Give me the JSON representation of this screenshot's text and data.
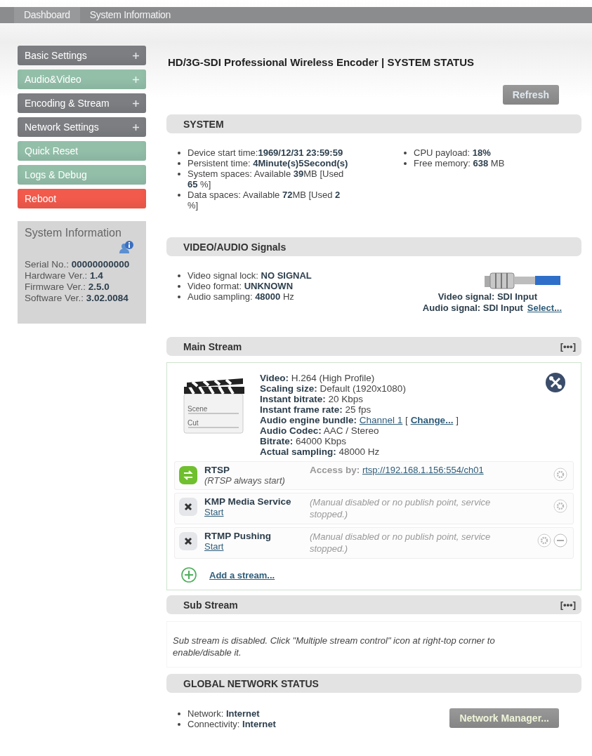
{
  "tabs": [
    {
      "label": "Dashboard",
      "selected": true
    },
    {
      "label": "System Information",
      "selected": false
    }
  ],
  "sidebar": {
    "items": [
      {
        "label": "Basic Settings",
        "color": "#7d7e82",
        "expandable": true
      },
      {
        "label": "Audio&Video",
        "color": "#93bfa9",
        "expandable": true
      },
      {
        "label": "Encoding & Stream",
        "color": "#7d7e82",
        "expandable": true
      },
      {
        "label": "Network Settings",
        "color": "#7d7e82",
        "expandable": true
      },
      {
        "label": "Quick Reset",
        "color": "#93bfa9",
        "expandable": false
      },
      {
        "label": "Logs & Debug",
        "color": "#93bfa9",
        "expandable": false
      },
      {
        "label": "Reboot",
        "color": "#f25a4c",
        "expandable": false
      }
    ],
    "info_panel": {
      "title": "System Information",
      "lines": [
        "Serial No.: **00000000000**",
        "Hardware Ver.: **1.4**",
        "Firmware Ver.: **2.5.0**",
        "Software Ver.: **3.02.0084**"
      ]
    }
  },
  "page_title": "HD/3G-SDI Professional Wireless Encoder | SYSTEM STATUS",
  "refresh_button": "Refresh",
  "system": {
    "title": "SYSTEM",
    "left": [
      "Device start time:**1969/12/31 23:59:59**",
      "Persistent time: **4Minute(s)5Second(s)**",
      "System spaces: Available **39**MB [Used **65** %]",
      "Data spaces: Available **72**MB [Used **2** %]"
    ],
    "right": [
      "CPU payload: **18%**",
      "Free memory: **638** MB"
    ]
  },
  "signals": {
    "title": "VIDEO/AUDIO Signals",
    "items": [
      "Video signal lock: **NO SIGNAL**",
      "Video format: **UNKNOWN**",
      "Audio sampling: **48000** Hz"
    ],
    "video_signal": "Video signal: SDI Input",
    "audio_signal": "Audio signal: SDI Input",
    "select_link": "Select..."
  },
  "main_stream": {
    "title": "Main Stream",
    "menu": "[•••]",
    "clapper_labels": [
      "Scene",
      "Cut"
    ],
    "details": [
      {
        "kind": "text",
        "label": "Video:",
        "value": "H.264 (High Profile)"
      },
      {
        "kind": "text",
        "label": "Scaling size:",
        "value": "Default (1920x1080)"
      },
      {
        "kind": "text",
        "label": "Instant bitrate:",
        "value": "20 Kbps"
      },
      {
        "kind": "text",
        "label": "Instant frame rate:",
        "value": "25 fps"
      },
      {
        "kind": "bundle",
        "label": "Audio engine bundle:",
        "link": "Channel 1",
        "bracket_open": "[",
        "action": "Change...",
        "bracket_close": "]"
      },
      {
        "kind": "text",
        "label": "Audio Codec:",
        "value": "AAC / Stereo"
      },
      {
        "kind": "text",
        "label": "Bitrate:",
        "value": "64000 Kbps"
      },
      {
        "kind": "text",
        "label": "Actual sampling:",
        "value": "48000 Hz"
      }
    ],
    "streams": [
      {
        "kind": "running",
        "name": "RTSP",
        "note": "(RTSP always start)",
        "access_label": "Access by:",
        "access_url": "rtsp://192.168.1.156:554/ch01",
        "removable": false
      },
      {
        "kind": "stopped",
        "name": "KMP Media Service",
        "start": "Start",
        "message": "(Manual disabled or no publish point, service stopped.)",
        "removable": false
      },
      {
        "kind": "stopped",
        "name": "RTMP Pushing",
        "start": "Start",
        "message": "(Manual disabled or no publish point, service stopped.)",
        "removable": true
      }
    ],
    "add_stream": "Add a stream..."
  },
  "sub_stream": {
    "title": "Sub Stream",
    "menu": "[•••]",
    "message": "Sub stream is disabled. Click \"Multiple stream control\" icon at right-top corner to enable/disable it."
  },
  "network": {
    "title": "GLOBAL NETWORK STATUS",
    "items": [
      "Network: **Internet**",
      "Connectivity: **Internet**"
    ],
    "button": "Network Manager..."
  }
}
